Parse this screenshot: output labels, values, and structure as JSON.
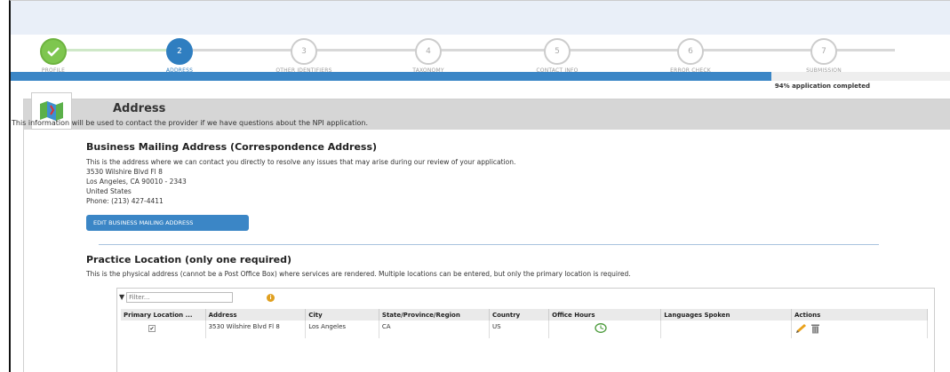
{
  "stepper": {
    "steps": [
      {
        "num": "",
        "label": "PROFILE",
        "state": "done"
      },
      {
        "num": "2",
        "label": "ADDRESS",
        "state": "current"
      },
      {
        "num": "3",
        "label": "OTHER IDENTIFIERS",
        "state": "pending"
      },
      {
        "num": "4",
        "label": "TAXONOMY",
        "state": "pending"
      },
      {
        "num": "5",
        "label": "CONTACT INFO",
        "state": "pending"
      },
      {
        "num": "6",
        "label": "ERROR CHECK",
        "state": "pending"
      },
      {
        "num": "7",
        "label": "SUBMISSION",
        "state": "pending"
      }
    ]
  },
  "progress": {
    "percent": 94,
    "label": "94% application completed",
    "color": "#3b86c6"
  },
  "address_section": {
    "title": "Address",
    "subtitle": "This information will be used to contact the provider if we have questions about the NPI application.",
    "icon": "map-icon"
  },
  "mailing": {
    "heading": "Business Mailing Address (Correspondence Address)",
    "description": "This is the address where we can contact you directly to resolve any issues that may arise during our review of your application.",
    "line1": "3530 Wilshire Blvd Fl 8",
    "line2": "Los Angeles, CA 90010 - 2343",
    "line3": "United States",
    "phone": "Phone: (213) 427-4411",
    "edit_button": "EDIT BUSINESS MAILING ADDRESS"
  },
  "practice": {
    "heading": "Practice Location (only one required)",
    "description": "This is the physical address (cannot be a Post Office Box) where services are rendered. Multiple locations can be entered, but only the primary location is required.",
    "filter_placeholder": "Filter...",
    "columns": [
      "Primary Location ...",
      "Address",
      "City",
      "State/Province/Region",
      "Country",
      "Office Hours",
      "Languages Spoken",
      "Actions"
    ],
    "rows": [
      {
        "primary": true,
        "address": "3530 Wilshire Blvd Fl 8",
        "city": "Los Angeles",
        "state": "CA",
        "country": "US",
        "office_hours_icon": "clock-icon",
        "languages": "",
        "actions": [
          "pencil-icon",
          "trash-icon"
        ]
      }
    ]
  }
}
